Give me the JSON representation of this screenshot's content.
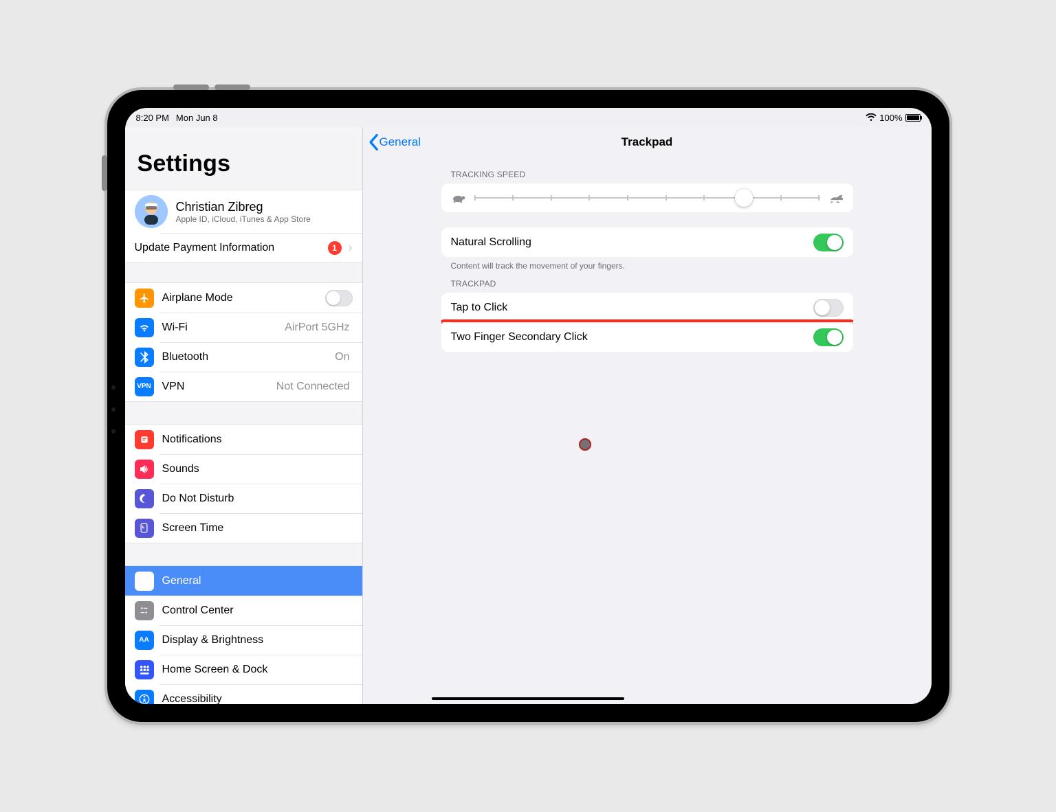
{
  "status": {
    "time": "8:20 PM",
    "date": "Mon Jun 8",
    "battery_pct": "100%"
  },
  "sidebar": {
    "title": "Settings",
    "profile": {
      "name": "Christian Zibreg",
      "desc": "Apple ID, iCloud, iTunes & App Store"
    },
    "payment": {
      "label": "Update Payment Information",
      "badge": "1"
    },
    "group1": {
      "airplane": "Airplane Mode",
      "wifi": "Wi-Fi",
      "wifi_value": "AirPort 5GHz",
      "bluetooth": "Bluetooth",
      "bt_value": "On",
      "vpn": "VPN",
      "vpn_value": "Not Connected"
    },
    "group2": {
      "notifications": "Notifications",
      "sounds": "Sounds",
      "dnd": "Do Not Disturb",
      "screentime": "Screen Time"
    },
    "group3": {
      "general": "General",
      "cc": "Control Center",
      "display": "Display & Brightness",
      "home": "Home Screen & Dock",
      "access": "Accessibility"
    }
  },
  "detail": {
    "back": "General",
    "title": "Trackpad",
    "tracking_header": "TRACKING SPEED",
    "tracking_position_pct": 78,
    "natural_scrolling": "Natural Scrolling",
    "natural_note": "Content will track the movement of your fingers.",
    "trackpad_header": "TRACKPAD",
    "tap_to_click": "Tap to Click",
    "secondary": "Two Finger Secondary Click",
    "natural_on": true,
    "tap_on": false,
    "secondary_on": true
  },
  "icons": {
    "airplane_color": "#ff9500",
    "wifi_color": "#0a7cff",
    "bt_color": "#0a7cff",
    "vpn_color": "#0a7cff",
    "notif_color": "#ff3b30",
    "sounds_color": "#ff2d55",
    "dnd_color": "#5856d6",
    "st_color": "#5856d6",
    "general_color": "#8e8e93",
    "cc_color": "#8e8e93",
    "display_color": "#0a7cff",
    "home_color": "#3355ff",
    "access_color": "#0a7cff"
  }
}
